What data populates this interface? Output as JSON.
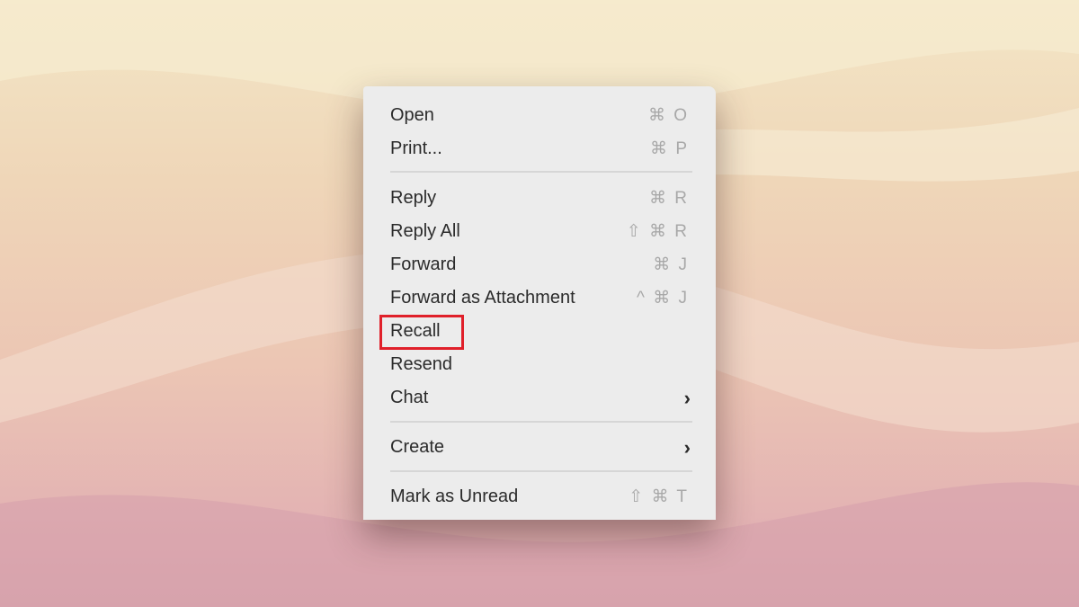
{
  "context_menu": {
    "items": [
      {
        "label": "Open",
        "shortcut": "⌘ O"
      },
      {
        "label": "Print...",
        "shortcut": "⌘ P"
      },
      {
        "label": "Reply",
        "shortcut": "⌘ R"
      },
      {
        "label": "Reply All",
        "shortcut": "⇧ ⌘ R"
      },
      {
        "label": "Forward",
        "shortcut": "⌘ J"
      },
      {
        "label": "Forward as Attachment",
        "shortcut": "^ ⌘ J"
      },
      {
        "label": "Recall",
        "shortcut": ""
      },
      {
        "label": "Resend",
        "shortcut": ""
      },
      {
        "label": "Chat",
        "submenu": "›"
      },
      {
        "label": "Create",
        "submenu": "›"
      },
      {
        "label": "Mark as Unread",
        "shortcut": "⇧ ⌘ T"
      }
    ],
    "highlight_color": "#e0202a"
  }
}
